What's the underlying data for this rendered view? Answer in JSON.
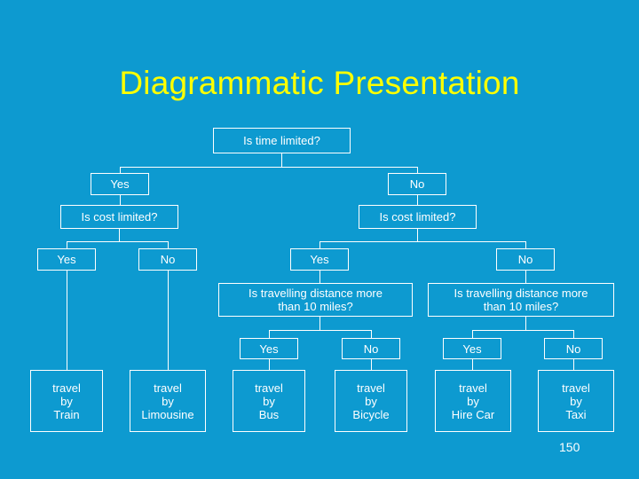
{
  "slide": {
    "title": "Diagrammatic Presentation",
    "page_number": "150",
    "background_color": "#0d9ad0",
    "title_color": "#ffff00",
    "line_color": "#ffffff",
    "text_color": "#ffffff"
  },
  "chart_data": {
    "type": "diagram",
    "title": "Diagrammatic Presentation",
    "diagram_kind": "decision-tree",
    "root": "Is time limited?",
    "nodes": [
      {
        "id": "n0",
        "label": "Is time limited?"
      },
      {
        "id": "n1",
        "label": "Yes"
      },
      {
        "id": "n2",
        "label": "No"
      },
      {
        "id": "n3",
        "label": "Is cost limited?"
      },
      {
        "id": "n4",
        "label": "Is cost limited?"
      },
      {
        "id": "n5",
        "label": "Yes"
      },
      {
        "id": "n6",
        "label": "No"
      },
      {
        "id": "n7",
        "label": "Yes"
      },
      {
        "id": "n8",
        "label": "No"
      },
      {
        "id": "n9",
        "label": "Is travelling distance more\nthan 10 miles?"
      },
      {
        "id": "n10",
        "label": "Is travelling distance more\nthan 10 miles?"
      },
      {
        "id": "n11",
        "label": "Yes"
      },
      {
        "id": "n12",
        "label": "No"
      },
      {
        "id": "n13",
        "label": "Yes"
      },
      {
        "id": "n14",
        "label": "No"
      },
      {
        "id": "n15",
        "label": "travel\nby\nTrain"
      },
      {
        "id": "n16",
        "label": "travel\nby\nLimousine"
      },
      {
        "id": "n17",
        "label": "travel\nby\nBus"
      },
      {
        "id": "n18",
        "label": "travel\nby\nBicycle"
      },
      {
        "id": "n19",
        "label": "travel\nby\nHire Car"
      },
      {
        "id": "n20",
        "label": "travel\nby\nTaxi"
      }
    ],
    "edges": [
      [
        "n0",
        "n1"
      ],
      [
        "n0",
        "n2"
      ],
      [
        "n1",
        "n3"
      ],
      [
        "n2",
        "n4"
      ],
      [
        "n3",
        "n5"
      ],
      [
        "n3",
        "n6"
      ],
      [
        "n4",
        "n7"
      ],
      [
        "n4",
        "n8"
      ],
      [
        "n5",
        "n15"
      ],
      [
        "n6",
        "n16"
      ],
      [
        "n7",
        "n9"
      ],
      [
        "n8",
        "n10"
      ],
      [
        "n9",
        "n11"
      ],
      [
        "n9",
        "n12"
      ],
      [
        "n10",
        "n13"
      ],
      [
        "n10",
        "n14"
      ],
      [
        "n11",
        "n17"
      ],
      [
        "n12",
        "n18"
      ],
      [
        "n13",
        "n19"
      ],
      [
        "n14",
        "n20"
      ]
    ]
  }
}
